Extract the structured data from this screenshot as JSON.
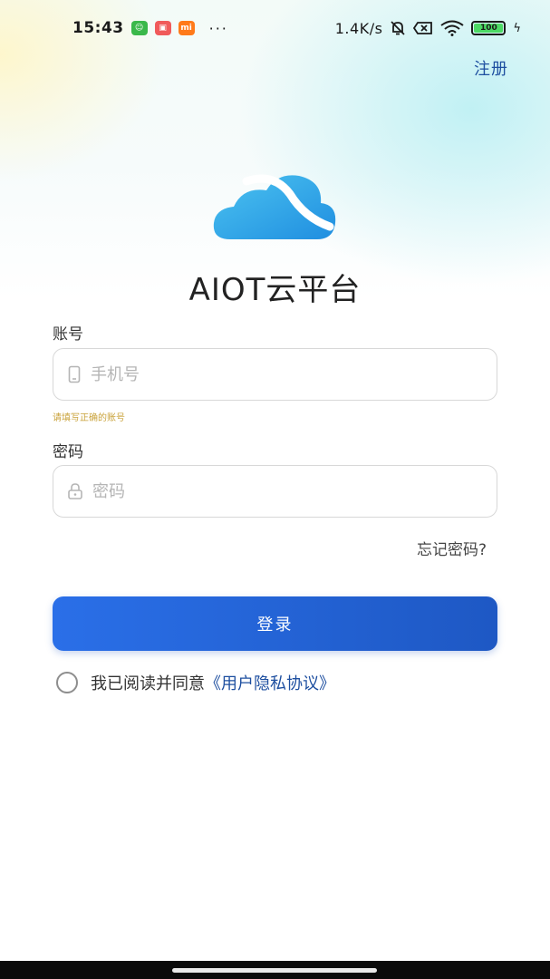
{
  "status_bar": {
    "time": "15:43",
    "apps": [
      {
        "icon": "message-app-icon",
        "color": "#3ab84a",
        "glyph": "☺"
      },
      {
        "icon": "briefcase-app-icon",
        "color": "#f05a5a",
        "glyph": "▣"
      },
      {
        "icon": "mi-app-icon",
        "color": "#ff7a1a",
        "glyph": "mi"
      }
    ],
    "more": "···",
    "net_speed": "1.4K/s",
    "battery": "100"
  },
  "header": {
    "register_label": "注册"
  },
  "app": {
    "title": "AIOT云平台"
  },
  "account": {
    "label": "账号",
    "placeholder": "手机号",
    "value": "",
    "hint": "请填写正确的账号"
  },
  "password": {
    "label": "密码",
    "placeholder": "密码",
    "value": ""
  },
  "forgot_label": "忘记密码?",
  "login_label": "登录",
  "agreement": {
    "text": "我已阅读并同意",
    "link": "《用户隐私协议》",
    "checked": false
  },
  "colors": {
    "primary": "#2a6fe8",
    "link": "#1e4fa0",
    "hint": "#c9a23a"
  }
}
